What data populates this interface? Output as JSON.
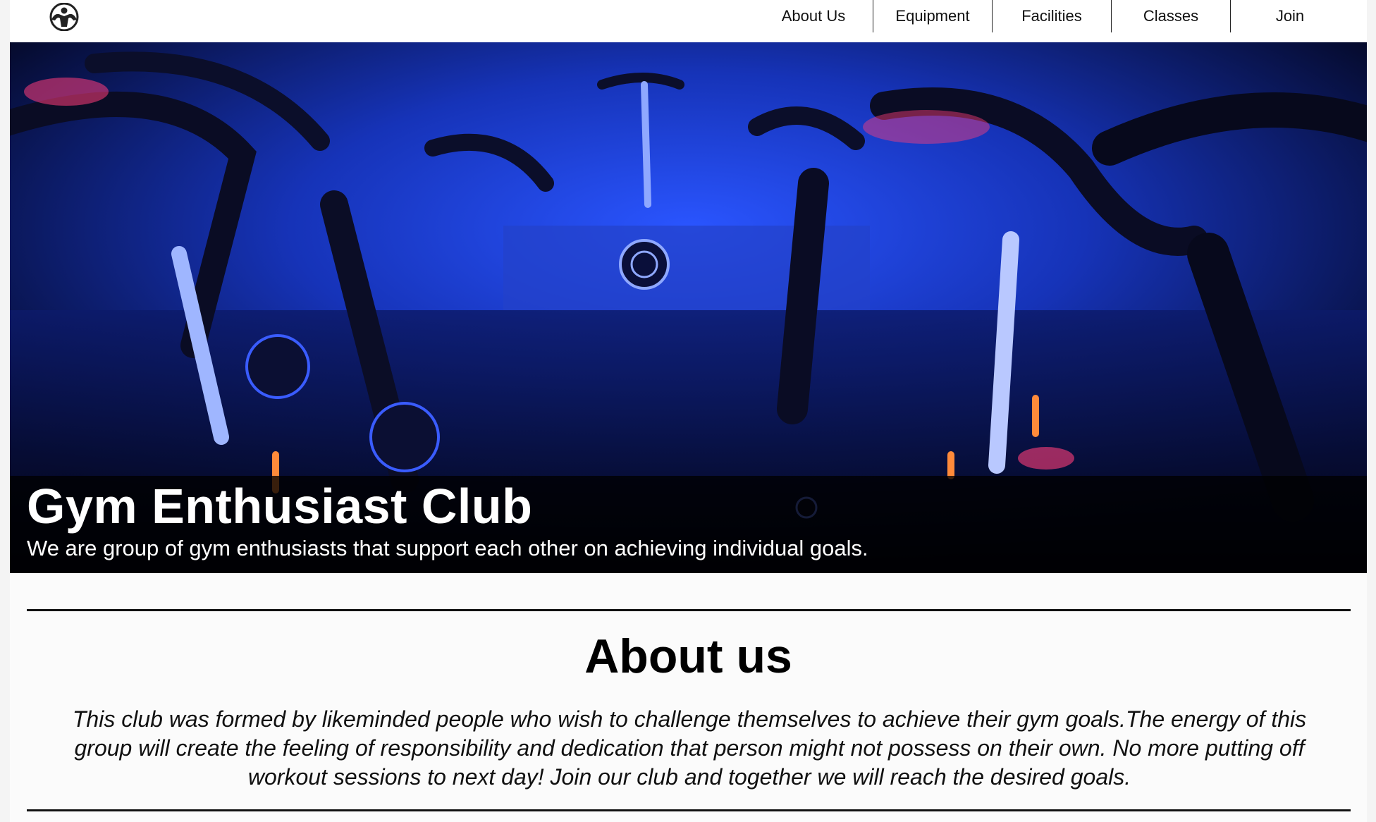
{
  "nav": {
    "logo_icon": "bodybuilder-logo-icon",
    "items": [
      {
        "label": "About Us"
      },
      {
        "label": "Equipment"
      },
      {
        "label": "Facilities"
      },
      {
        "label": "Classes"
      },
      {
        "label": "Join"
      }
    ]
  },
  "hero": {
    "image": "spin-class-photo",
    "title": "Gym Enthusiast Club",
    "subtitle": "We are group of gym enthusiasts that support each other on achieving individual goals."
  },
  "about": {
    "heading": "About us",
    "text": "This club was formed by likeminded people who wish to challenge themselves to achieve their gym goals.The energy of this group will create the feeling of responsibility and dedication that person might not possess on their own. No more putting off workout sessions to next day! Join our club and together we will reach the desired goals."
  },
  "colors": {
    "hero_blue": "#1b3fd6",
    "hero_dark": "#04061c",
    "accent_pink": "#ff3d7a",
    "accent_orange": "#ff8a3a"
  }
}
